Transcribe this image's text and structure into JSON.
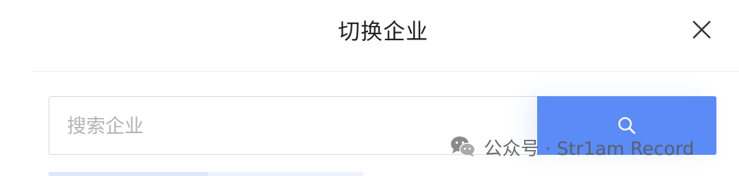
{
  "header": {
    "title": "切换企业"
  },
  "search": {
    "placeholder": "搜索企业",
    "value": ""
  },
  "watermark": {
    "text": "公众号 · Str1am Record"
  },
  "colors": {
    "accent": "#5b8bf7",
    "title_text": "#222222",
    "placeholder_text": "#b3b3b3",
    "divider": "#ececec",
    "input_border": "#d9d9d9"
  },
  "icons": {
    "close": "close-icon",
    "search": "search-icon",
    "watermark_logo": "wechat-icon"
  }
}
